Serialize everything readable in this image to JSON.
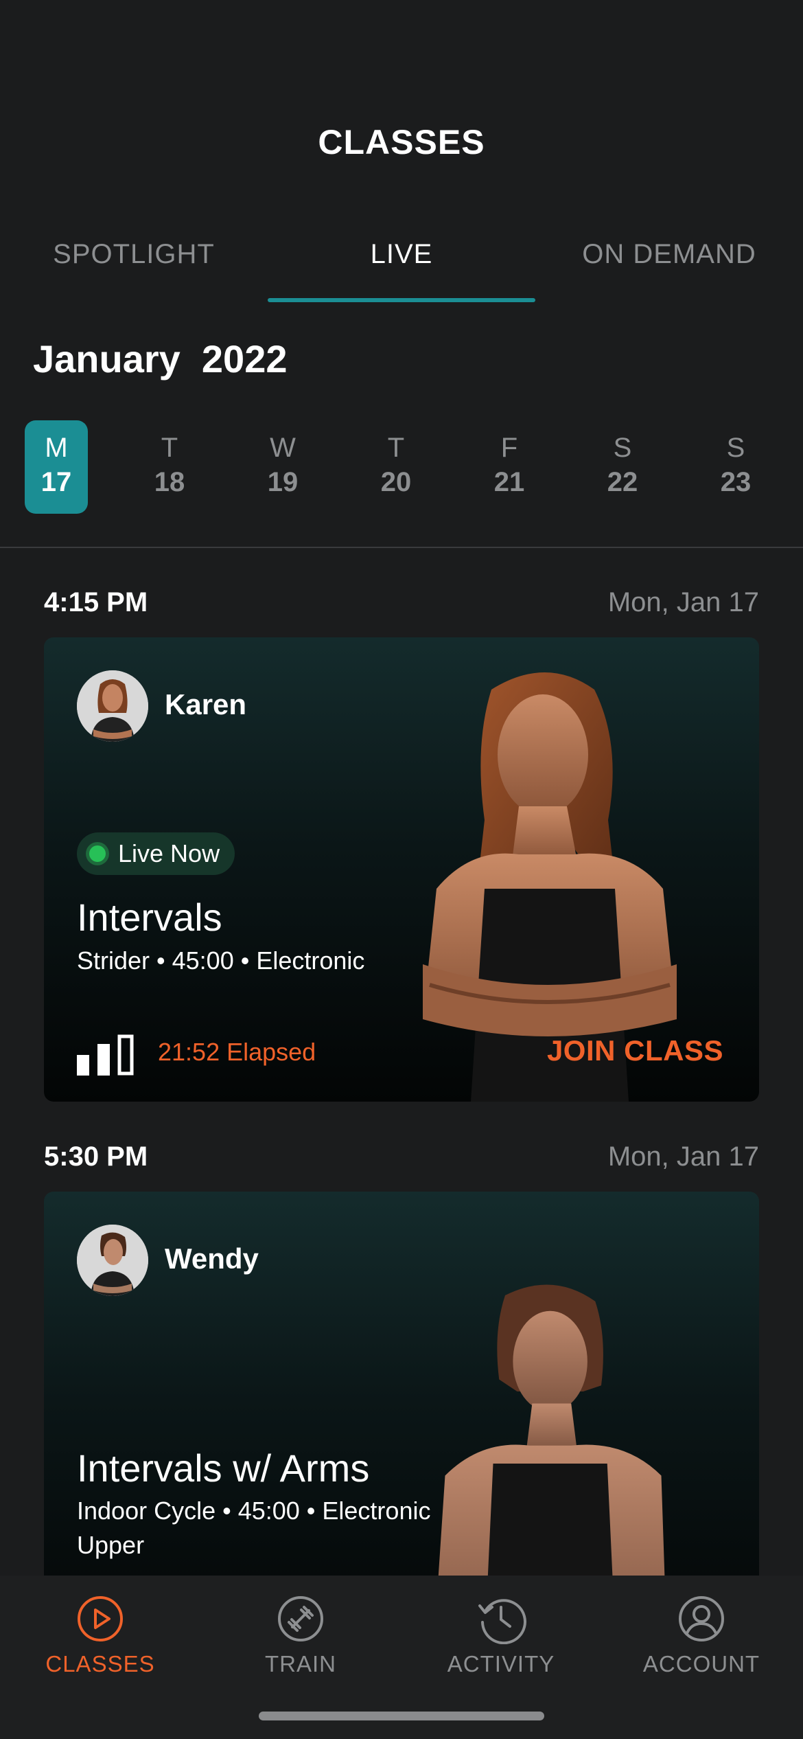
{
  "header": {
    "title": "CLASSES"
  },
  "tabs": [
    {
      "label": "SPOTLIGHT",
      "active": false
    },
    {
      "label": "LIVE",
      "active": true
    },
    {
      "label": "ON DEMAND",
      "active": false
    }
  ],
  "calendar": {
    "month_label": "January  2022",
    "days": [
      {
        "letter": "M",
        "number": "17",
        "selected": true
      },
      {
        "letter": "T",
        "number": "18",
        "selected": false
      },
      {
        "letter": "W",
        "number": "19",
        "selected": false
      },
      {
        "letter": "T",
        "number": "20",
        "selected": false
      },
      {
        "letter": "F",
        "number": "21",
        "selected": false
      },
      {
        "letter": "S",
        "number": "22",
        "selected": false
      },
      {
        "letter": "S",
        "number": "23",
        "selected": false
      }
    ]
  },
  "classes": [
    {
      "time": "4:15 PM",
      "date": "Mon, Jan 17",
      "instructor": "Karen",
      "live_badge": "Live Now",
      "name": "Intervals",
      "meta": "Strider • 45:00 • Electronic",
      "elapsed": "21:52 Elapsed",
      "intensity_level": "2 of 3",
      "join_label": "JOIN CLASS"
    },
    {
      "time": "5:30 PM",
      "date": "Mon, Jan 17",
      "instructor": "Wendy",
      "name": "Intervals w/ Arms",
      "meta": "Indoor Cycle • 45:00 • Electronic Upper"
    }
  ],
  "tabbar": {
    "items": [
      {
        "label": "CLASSES",
        "icon": "play-circle-icon",
        "active": true
      },
      {
        "label": "TRAIN",
        "icon": "dumbbell-icon",
        "active": false
      },
      {
        "label": "ACTIVITY",
        "icon": "history-clock-icon",
        "active": false
      },
      {
        "label": "ACCOUNT",
        "icon": "user-circle-icon",
        "active": false
      }
    ]
  },
  "colors": {
    "accent_teal": "#1b8e94",
    "accent_orange": "#f0622a",
    "live_green": "#27c057",
    "background": "#1b1c1d"
  }
}
